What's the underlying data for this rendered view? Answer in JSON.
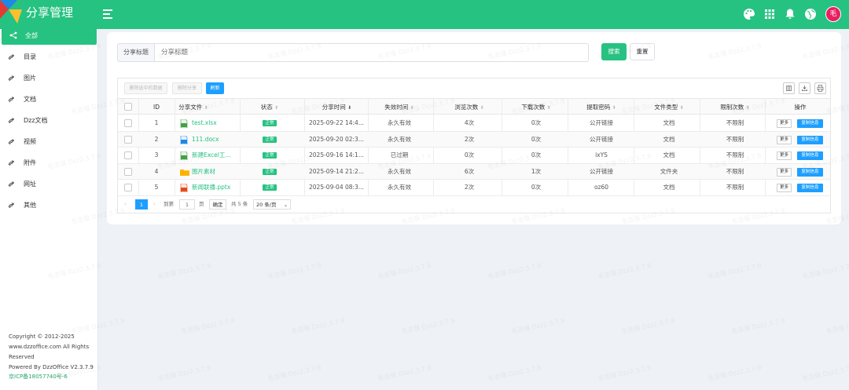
{
  "app": {
    "title": "分享管理"
  },
  "header": {
    "icons": [
      "palette-icon",
      "apps-grid-icon",
      "bell-icon",
      "globe-icon"
    ],
    "avatar_text": "毛",
    "color": "#26c281"
  },
  "sidebar": {
    "items": [
      {
        "label": "全部",
        "icon": "share-icon",
        "active": true
      },
      {
        "label": "目录",
        "icon": "share-arrow-icon"
      },
      {
        "label": "图片",
        "icon": "share-arrow-icon"
      },
      {
        "label": "文档",
        "icon": "share-arrow-icon"
      },
      {
        "label": "Dzz文档",
        "icon": "share-arrow-icon"
      },
      {
        "label": "视频",
        "icon": "share-arrow-icon"
      },
      {
        "label": "附件",
        "icon": "share-arrow-icon"
      },
      {
        "label": "网址",
        "icon": "share-arrow-icon"
      },
      {
        "label": "其他",
        "icon": "share-arrow-icon"
      }
    ],
    "footer": {
      "copyright": "Copyright © 2012-2025",
      "site": "www.dzzoffice.com All Rights",
      "reserved": "Reserved",
      "powered": "Powered By DzzOffice V2.3.7.9",
      "icp": "京ICP备18057740号-6"
    }
  },
  "search": {
    "label": "分享标题",
    "placeholder": "分享标题",
    "search_button": "搜索",
    "reset_button": "重置"
  },
  "toolbar": {
    "delete_invalid": "删除选中的数据",
    "delete_share": "删除分享",
    "refresh": "刷新"
  },
  "table": {
    "columns": [
      "ID",
      "分享文件",
      "状态",
      "分享时间",
      "失效时间",
      "浏览次数",
      "下载次数",
      "提取密码",
      "文件类型",
      "限制次数",
      "操作"
    ],
    "rows": [
      {
        "id": "1",
        "file": "test.xlsx",
        "file_icon": "excel-file-icon",
        "status": "正常",
        "time": "2025-09-22 14:4...",
        "expire": "永久有效",
        "views": "4次",
        "downloads": "0次",
        "password": "公开链接",
        "type": "文档",
        "limit": "不限制"
      },
      {
        "id": "2",
        "file": "111.docx",
        "file_icon": "word-file-icon",
        "status": "正常",
        "time": "2025-09-20 02:3...",
        "expire": "永久有效",
        "views": "2次",
        "downloads": "0次",
        "password": "公开链接",
        "type": "文档",
        "limit": "不限制"
      },
      {
        "id": "3",
        "file": "新建Excel工...",
        "file_icon": "excel-file-icon",
        "status": "正常",
        "time": "2025-09-16 14:1...",
        "expire": "已过期",
        "views": "0次",
        "downloads": "0次",
        "password": "ixYS",
        "type": "文档",
        "limit": "不限制"
      },
      {
        "id": "4",
        "file": "图片素材",
        "file_icon": "folder-icon",
        "status": "正常",
        "time": "2025-09-14 21:2...",
        "expire": "永久有效",
        "views": "6次",
        "downloads": "1次",
        "password": "公开链接",
        "type": "文件夹",
        "limit": "不限制"
      },
      {
        "id": "5",
        "file": "新闻联播.pptx",
        "file_icon": "ppt-file-icon",
        "status": "正常",
        "time": "2025-09-04 08:3...",
        "expire": "永久有效",
        "views": "2次",
        "downloads": "0次",
        "password": "oz60",
        "type": "文档",
        "limit": "不限制"
      }
    ],
    "op_more": "更多",
    "op_copy": "复制信息"
  },
  "pager": {
    "current_page": "1",
    "goto_label": "到第",
    "goto_value": "1",
    "page_unit": "页",
    "confirm": "确定",
    "total": "共 5 条",
    "page_size": "20 条/页"
  },
  "watermark_text": "毛志强 Dzz2.3.7.9"
}
